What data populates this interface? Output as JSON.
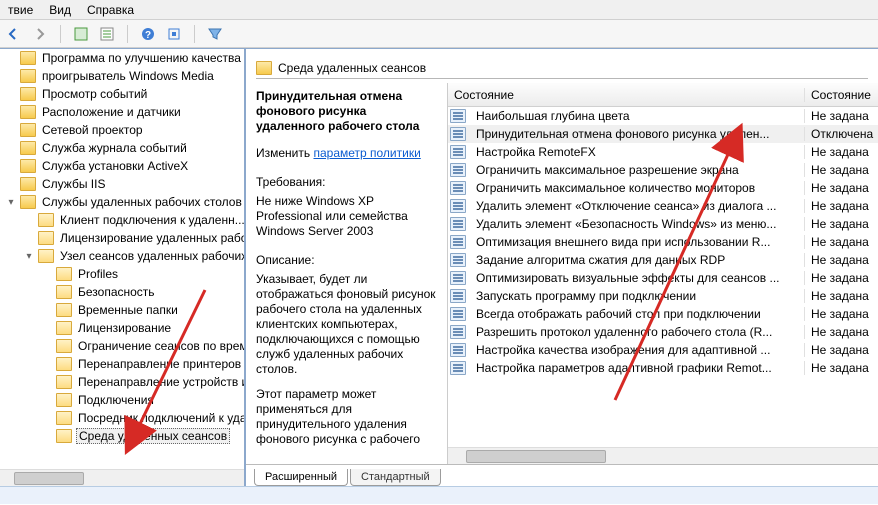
{
  "menu": {
    "items": [
      "твие",
      "Вид",
      "Справка"
    ]
  },
  "breadcrumb": {
    "label": "Среда удаленных сеансов"
  },
  "tree": {
    "items": [
      {
        "indent": 0,
        "exp": "",
        "label": "Программа по улучшению качества ..."
      },
      {
        "indent": 0,
        "exp": "",
        "label": "проигрыватель Windows Media"
      },
      {
        "indent": 0,
        "exp": "",
        "label": "Просмотр событий"
      },
      {
        "indent": 0,
        "exp": "",
        "label": "Расположение и датчики"
      },
      {
        "indent": 0,
        "exp": "",
        "label": "Сетевой проектор"
      },
      {
        "indent": 0,
        "exp": "",
        "label": "Служба журнала событий"
      },
      {
        "indent": 0,
        "exp": "",
        "label": "Служба установки ActiveX"
      },
      {
        "indent": 0,
        "exp": "",
        "label": "Службы IIS"
      },
      {
        "indent": 0,
        "exp": "▾",
        "label": "Службы удаленных рабочих столов"
      },
      {
        "indent": 1,
        "exp": "",
        "label": "Клиент подключения к удаленн..."
      },
      {
        "indent": 1,
        "exp": "",
        "label": "Лицензирование удаленных рабоч..."
      },
      {
        "indent": 1,
        "exp": "▾",
        "label": "Узел сеансов удаленных рабочих ст..."
      },
      {
        "indent": 2,
        "exp": "",
        "label": "Profiles"
      },
      {
        "indent": 2,
        "exp": "",
        "label": "Безопасность"
      },
      {
        "indent": 2,
        "exp": "",
        "label": "Временные папки"
      },
      {
        "indent": 2,
        "exp": "",
        "label": "Лицензирование"
      },
      {
        "indent": 2,
        "exp": "",
        "label": "Ограничение сеансов по врем..."
      },
      {
        "indent": 2,
        "exp": "",
        "label": "Перенаправление принтеров"
      },
      {
        "indent": 2,
        "exp": "",
        "label": "Перенаправление устройств и ..."
      },
      {
        "indent": 2,
        "exp": "",
        "label": "Подключения"
      },
      {
        "indent": 2,
        "exp": "",
        "label": "Посредник подключений к удал..."
      },
      {
        "indent": 2,
        "exp": "",
        "label": "Среда удаленных сеансов",
        "selected": true
      }
    ]
  },
  "desc": {
    "title": "Принудительная отмена фонового рисунка удаленного рабочего стола",
    "edit_prefix": "Изменить ",
    "edit_link": "параметр политики",
    "req_label": "Требования:",
    "req_text": "Не ниже Windows XP Professional или семейства Windows Server 2003",
    "desc_label": "Описание:",
    "desc_text1": "Указывает, будет ли отображаться фоновый рисунок рабочего стола на удаленных клиентских компьютерах, подключающихся с помощью служб удаленных рабочих столов.",
    "desc_text2": "Этот параметр может применяться для принудительного удаления фонового рисунка с рабочего"
  },
  "list": {
    "headers": {
      "name": "Состояние",
      "state": "Состояние"
    },
    "rows": [
      {
        "name": "Наибольшая глубина цвета",
        "state": "Не задана"
      },
      {
        "name": "Принудительная отмена фонового рисунка удален...",
        "state": "Отключена",
        "selected": true
      },
      {
        "name": "Настройка RemoteFX",
        "state": "Не задана"
      },
      {
        "name": "Ограничить максимальное разрешение экрана",
        "state": "Не задана"
      },
      {
        "name": "Ограничить максимальное количество мониторов",
        "state": "Не задана"
      },
      {
        "name": "Удалить элемент «Отключение сеанса» из диалога ...",
        "state": "Не задана"
      },
      {
        "name": "Удалить элемент «Безопасность Windows» из меню...",
        "state": "Не задана"
      },
      {
        "name": "Оптимизация внешнего вида при использовании R...",
        "state": "Не задана"
      },
      {
        "name": "Задание алгоритма сжатия для данных RDP",
        "state": "Не задана"
      },
      {
        "name": "Оптимизировать визуальные эффекты для сеансов ...",
        "state": "Не задана"
      },
      {
        "name": "Запускать программу при подключении",
        "state": "Не задана"
      },
      {
        "name": "Всегда отображать рабочий стол при подключении",
        "state": "Не задана"
      },
      {
        "name": "Разрешить протокол удаленного рабочего стола (R...",
        "state": "Не задана"
      },
      {
        "name": "Настройка качества изображения для адаптивной ...",
        "state": "Не задана"
      },
      {
        "name": "Настройка параметров адаптивной графики Remot...",
        "state": "Не задана"
      }
    ]
  },
  "tabs": {
    "extended": "Расширенный",
    "standard": "Стандартный"
  }
}
